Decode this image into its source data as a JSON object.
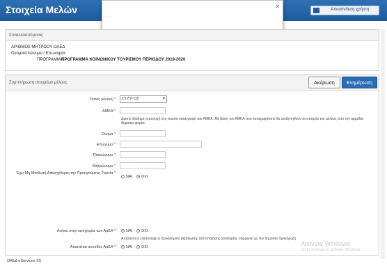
{
  "app": {
    "title": "Στοιχεία Μελών",
    "user_label": "Αποσύνδεση χρήστη"
  },
  "modal": {
    "text": "."
  },
  "applicant_panel": {
    "heading": "Συναλλασσόμενος",
    "registry_label": "ΑΡΙΘΜΟΣ ΜΗΤΡΩΟΥ ΟΑΕΔ",
    "name_label": "Ονοματεπώνυμο / Επωνυμία",
    "program_label": "ΠΡΟΓΡΑΜΜΑ",
    "program_value": "ΠΡΟΓΡΑΜΜΑ ΚΟΙΝΩΝΙΚΟΥ ΤΟΥΡΙΣΜΟΥ ΠΕΡΙΟΔΟΥ 2019-2020"
  },
  "form_panel": {
    "heading": "Συμπλήρωση στοιχείων μέλους",
    "cancel_label": "Ακύρωση",
    "update_label": "Ενημέρωση",
    "member_type_label": "Τύπος μέλους",
    "member_type_value": "ΣΥΖΥΓΟΣ",
    "amka_label": "ΑΜΚΑ",
    "amka_help": "Δώστε ιδιαίτερη προσοχή στη σωστή καταγραφή του ΑΜΚΑ. Με βάση τον ΑΜΚΑ που καταχωρήσατε θα αναζητηθούν τα στοιχεία του μέλους από την αρμόδια δημόσια φορέα",
    "first_name_label": "Όνομα",
    "last_name_label": "Επώνυμο",
    "father_label": "Πατρώνυμο",
    "mother_label": "Μητρώνυμο",
    "employment_label": "Έχει Μη Μισθωτή Απασχόληση την Προηγούμενη Τριετία",
    "yes_label": "ΝΑΙ",
    "no_label": "ΟΧΙ",
    "amea_label": "Ανήκει στην κατηγορία των ΑμΕΑ",
    "amea_help": "Απαιτείται η επισύναψη ή προσκόμιση βεβαίωσης πιστοποίησης αναπηρίας σύμφωνα με την δημόσια προκήρυξη",
    "companion_label": "Απαιτείται συνοδός ΑμΕΑ"
  },
  "watermark": {
    "title": "Activate Windows",
    "subtitle": "Go to Settings to activate Windows."
  },
  "footer": {
    "text": "ΟΑΕΔ eServices ©5"
  },
  "colors": {
    "brand": "#2f70b4",
    "primary_button": "#2b6cb7",
    "required": "#c0392b"
  }
}
